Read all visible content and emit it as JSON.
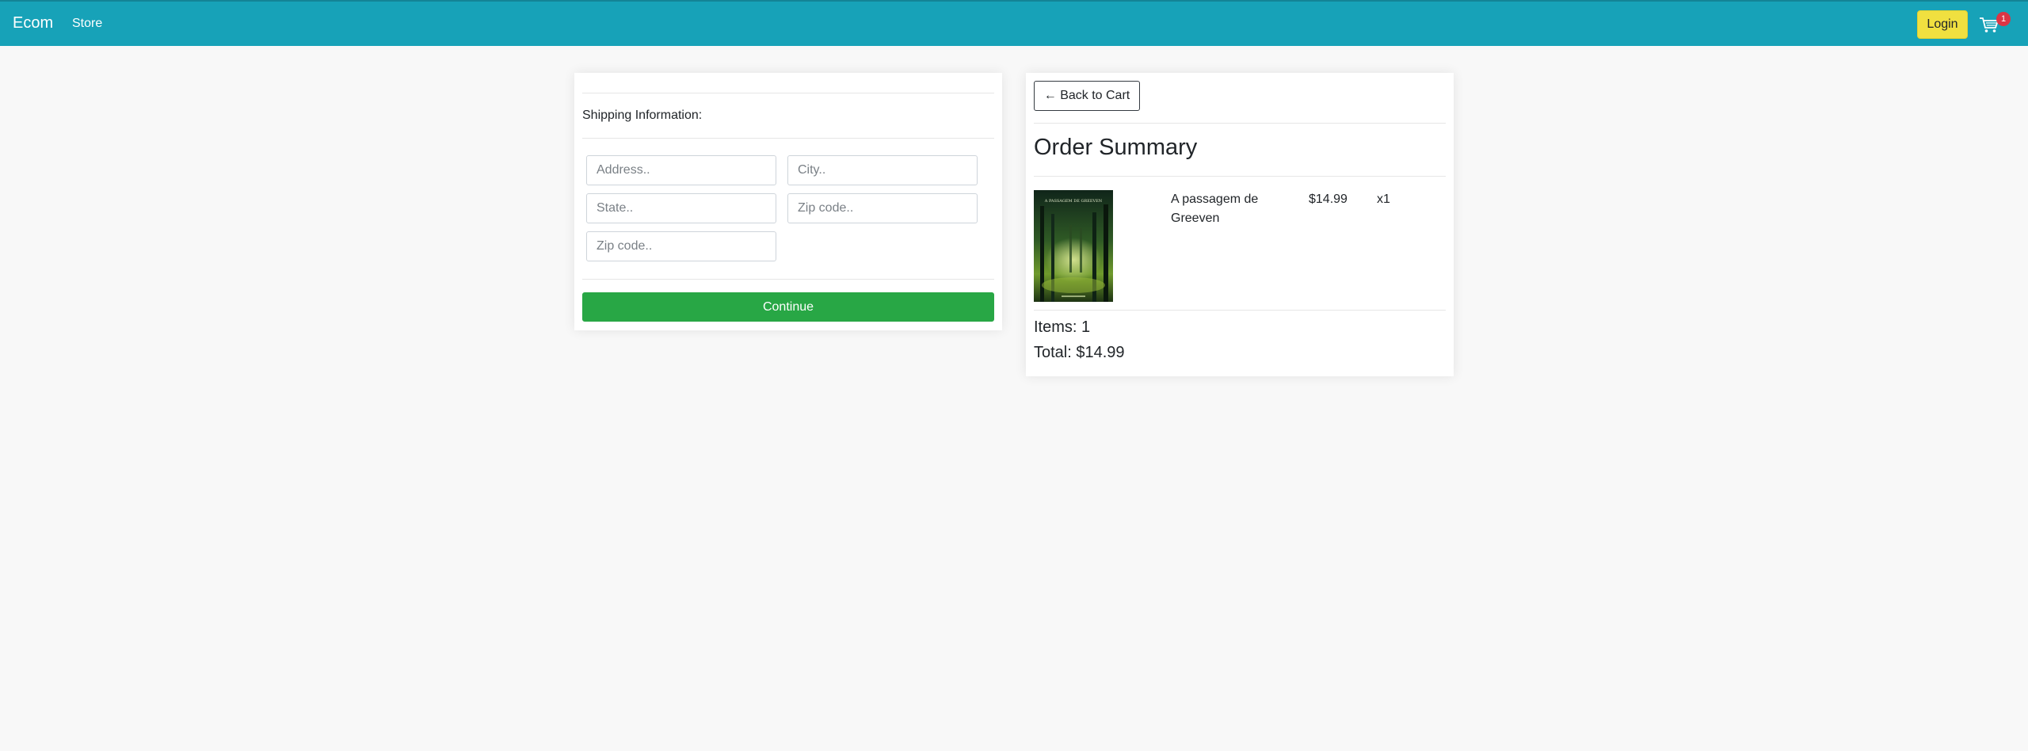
{
  "navbar": {
    "brand": "Ecom",
    "links": [
      "Store"
    ],
    "login_label": "Login",
    "cart_count": "1",
    "bg_color": "#17a2b8"
  },
  "shipping_form": {
    "heading": "Shipping Information:",
    "fields": {
      "address_placeholder": "Address..",
      "city_placeholder": "City..",
      "state_placeholder": "State..",
      "zip_placeholder": "Zip code..",
      "zip2_placeholder": "Zip code.."
    },
    "continue_label": "Continue"
  },
  "order_summary": {
    "back_label": "← Back to Cart",
    "title": "Order Summary",
    "items": [
      {
        "cover_text": "A PASSAGEM DE GREEVEN",
        "name": "A passagem de Greeven",
        "price": "$14.99",
        "quantity": "x1"
      }
    ],
    "items_count": "Items: 1",
    "total": "Total: $14.99"
  },
  "colors": {
    "success": "#28a745",
    "danger": "#dc3545",
    "login_button": "#f0e040"
  }
}
